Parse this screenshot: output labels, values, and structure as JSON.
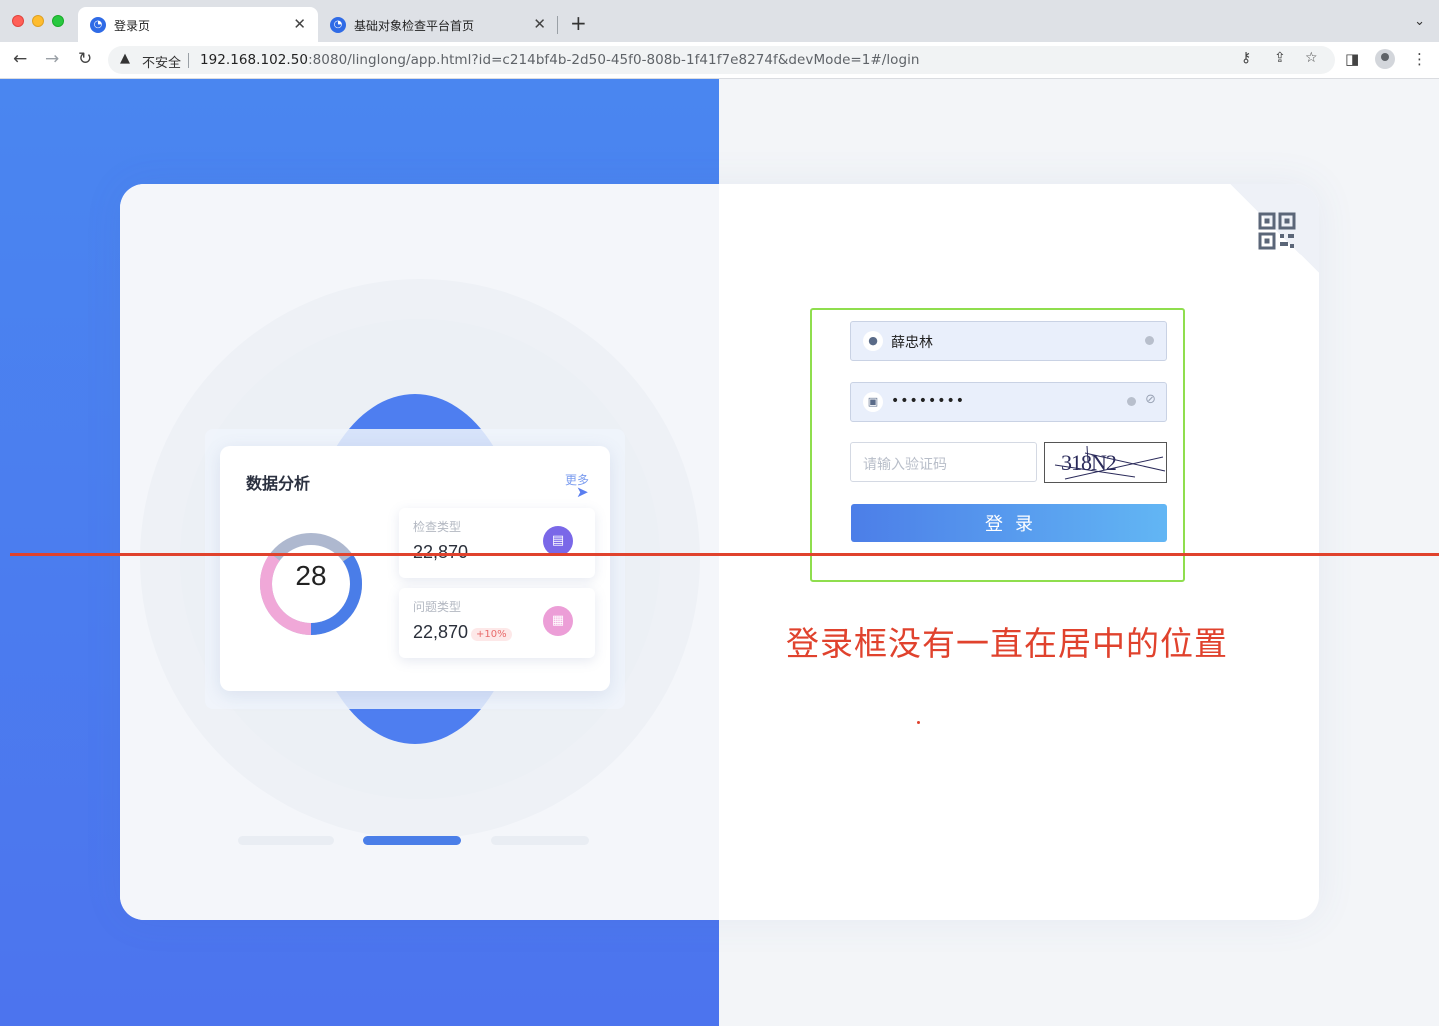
{
  "browser": {
    "tabs": [
      {
        "label": "登录页",
        "active": true
      },
      {
        "label": "基础对象检查平台首页",
        "active": false
      }
    ],
    "security_label": "不安全",
    "url_host": "192.168.102.50",
    "url_rest": ":8080/linglong/app.html?id=c214bf4b-2d50-45f0-808b-1f41f7e8274f&devMode=1#/login"
  },
  "illustration": {
    "title": "数据分析",
    "more": "更多",
    "donut_value": "28",
    "stats": [
      {
        "label": "检查类型",
        "value": "22,870"
      },
      {
        "label": "问题类型",
        "value": "22,870",
        "badge": "+10%"
      }
    ]
  },
  "login": {
    "username": "薛忠林",
    "password_mask": "••••••••",
    "captcha_placeholder": "请输入验证码",
    "captcha_text": "318N2",
    "submit_label": "登录"
  },
  "annotation": {
    "note": "登录框没有一直在居中的位置",
    "color": "#e0422d"
  },
  "colors": {
    "accent": "#4c7ee8",
    "highlight": "#8fde4e"
  }
}
